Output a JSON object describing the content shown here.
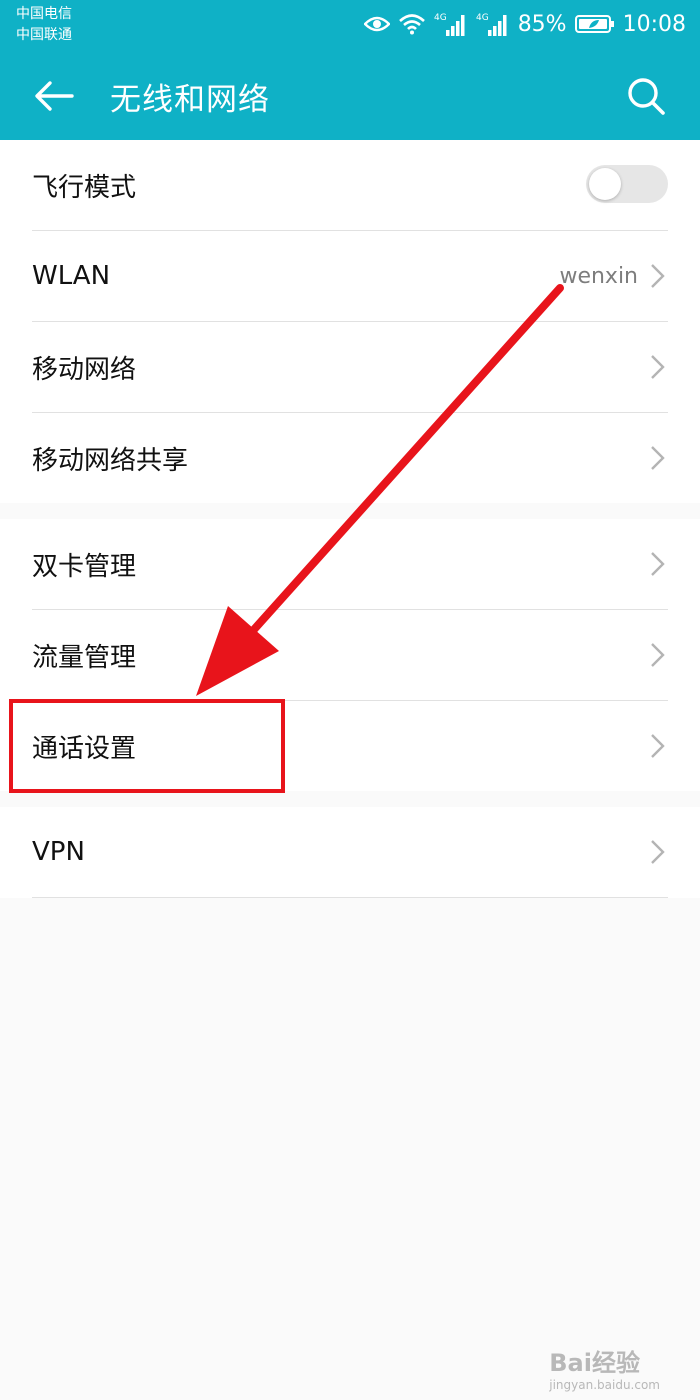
{
  "status_bar": {
    "carrier_1": "中国电信",
    "carrier_2": "中国联通",
    "network_1": "4G",
    "network_2": "4G",
    "battery": "85%",
    "time": "10:08"
  },
  "header": {
    "title": "无线和网络",
    "background_color": "#0fb1c6"
  },
  "groups": [
    {
      "items": [
        {
          "label": "飞行模式",
          "control": "toggle",
          "toggle_on": false
        },
        {
          "label": "WLAN",
          "value": "wenxin",
          "control": "chevron"
        },
        {
          "label": "移动网络",
          "control": "chevron"
        },
        {
          "label": "移动网络共享",
          "control": "chevron"
        }
      ]
    },
    {
      "items": [
        {
          "label": "双卡管理",
          "control": "chevron"
        },
        {
          "label": "流量管理",
          "control": "chevron"
        },
        {
          "label": "通话设置",
          "control": "chevron",
          "highlighted": true
        }
      ]
    },
    {
      "items": [
        {
          "label": "VPN",
          "control": "chevron"
        }
      ]
    }
  ],
  "annotation": {
    "color": "#e8141b",
    "target": "通话设置"
  },
  "watermark": {
    "text": "Bai经验",
    "sub": "jingyan.baidu.com"
  }
}
